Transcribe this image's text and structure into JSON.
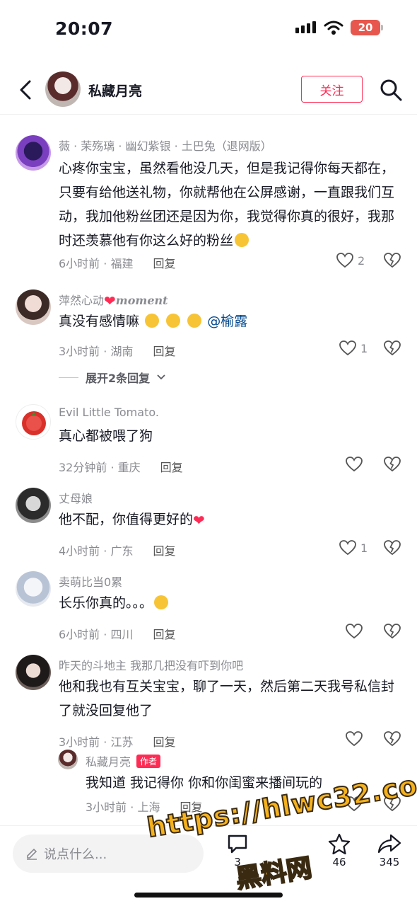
{
  "status": {
    "time": "20:07",
    "battery": "20"
  },
  "header": {
    "username": "私藏月亮",
    "follow_label": "关注"
  },
  "comments": [
    {
      "user": "薇 · 茉殇璃 · 幽幻紫银 · 土巴兔（退网版）",
      "text": "心疼你宝宝，虽然看他没几天，但是我记得你每天都在，只要有给他送礼物，你就帮他在公屏感谢，一直跟我们互动，我加他粉丝团还是因为你，我觉得你真的很好，我那时还羡慕他有你这么好的粉丝",
      "time": "6小时前 · 福建",
      "reply": "回复",
      "likes": "2"
    },
    {
      "user": "萍然心动",
      "user_suffix": "moment",
      "text": "真没有感情嘛",
      "mention": "@榆露",
      "time": "3小时前 · 湖南",
      "reply": "回复",
      "likes": "1",
      "expand": "展开2条回复"
    },
    {
      "user": "Evil Little Tomato.",
      "text": "真心都被喂了狗",
      "time": "32分钟前 · 重庆",
      "reply": "回复",
      "likes": ""
    },
    {
      "user": "丈母娘",
      "text": "他不配，你值得更好的",
      "time": "4小时前 · 广东",
      "reply": "回复",
      "likes": "1"
    },
    {
      "user": "卖萌比当0累",
      "text": "长乐你真的。。。",
      "time": "6小时前 · 四川",
      "reply": "回复",
      "likes": ""
    },
    {
      "user": "昨天的斗地主 我那几把没有吓到你吧",
      "text": "他和我也有互关宝宝，聊了一天，然后第二天我号私信封了就没回复他了",
      "time": "3小时前 · 江苏",
      "reply": "回复",
      "likes": ""
    },
    {
      "user": "私藏月亮",
      "author_tag": "作者",
      "text": "我知道 我记得你 你和你闺蜜来播间玩的",
      "time": "3小时前 · 上海",
      "reply": "回复",
      "likes": ""
    }
  ],
  "bottom": {
    "placeholder": "说点什么...",
    "count_comment": "3",
    "count_star": "46",
    "count_share": "345"
  },
  "watermark": {
    "url": "https://hlwc32.com",
    "name": "黑料网"
  },
  "colors": {
    "accent": "#fe2c55",
    "mention": "#04498d",
    "muted": "#8a8b91"
  }
}
